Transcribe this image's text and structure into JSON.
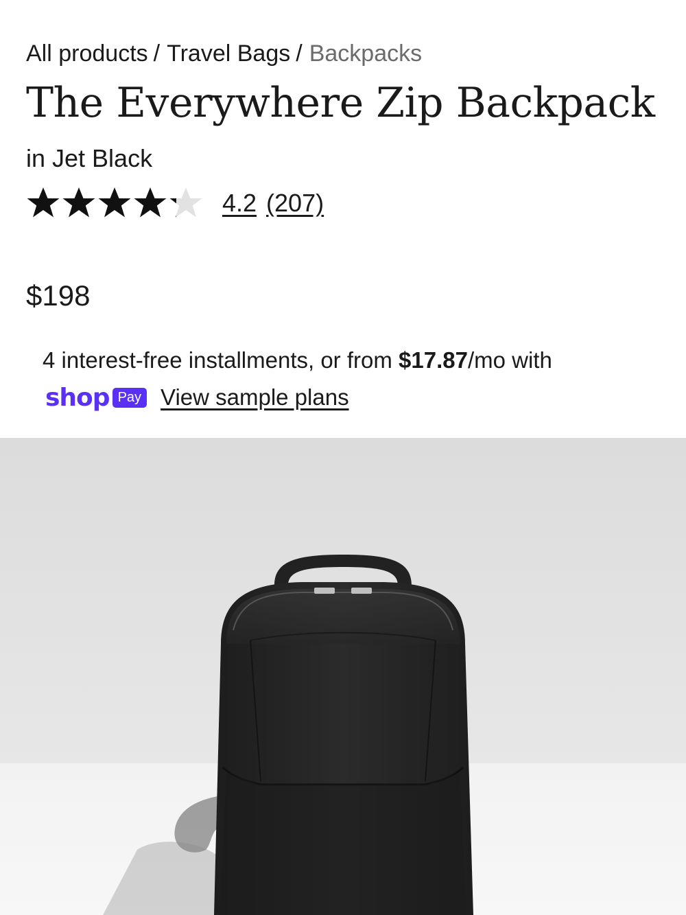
{
  "breadcrumb": {
    "items": [
      {
        "label": "All products"
      },
      {
        "label": "Travel Bags"
      },
      {
        "label": "Backpacks"
      }
    ],
    "separator": "/"
  },
  "product": {
    "title": "The Everywhere Zip Backpack",
    "variant": "in Jet Black",
    "rating": {
      "value": 4.2,
      "value_label": "4.2",
      "count_label": "(207)",
      "max_stars": 5,
      "star_color": "#111111",
      "empty_star_color": "#e2e2e2"
    },
    "price": "$198"
  },
  "installments": {
    "prefix": "4 interest-free installments, or from ",
    "amount": "$17.87",
    "suffix": "/mo with",
    "provider_word": "shop",
    "provider_badge": "Pay",
    "provider_color": "#5a31f4",
    "link_label": "View sample plans"
  },
  "image": {
    "icon": "backpack-photo"
  }
}
